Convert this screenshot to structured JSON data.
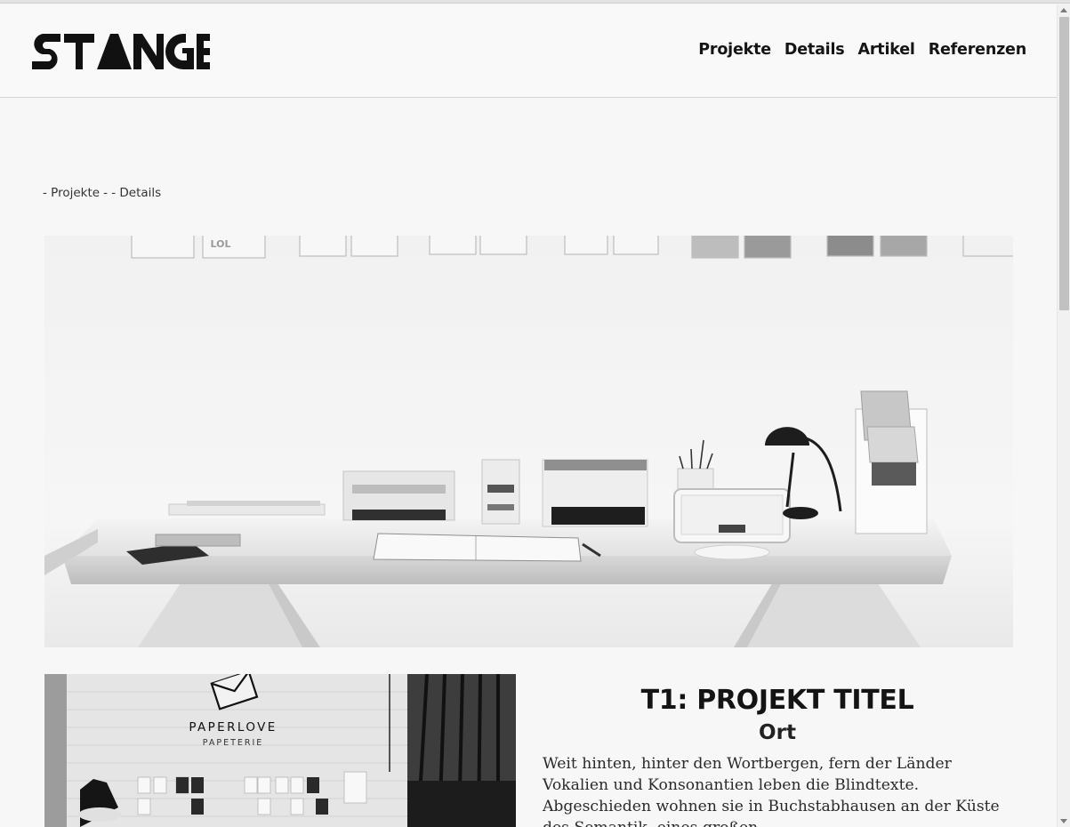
{
  "site": {
    "logo_text": "STANGE"
  },
  "nav": {
    "items": [
      {
        "label": "Projekte"
      },
      {
        "label": "Details"
      },
      {
        "label": "Artikel"
      },
      {
        "label": "Referenzen"
      }
    ]
  },
  "breadcrumb": {
    "parts": [
      "- Projekte",
      "- - Details"
    ]
  },
  "images": {
    "side_photo_text": {
      "brand": "PAPERLOVE",
      "sub": "PAPETERIE"
    }
  },
  "project": {
    "title": "T1: PROJEKT TITEL",
    "location": "Ort",
    "text": "Weit hinten, hinter den Wortbergen, fern der Länder Vokalien und Konsonantien leben die Blindtexte. Abgeschieden wohnen sie in Buchstabhausen an der Küste des Semantik, eines großen"
  },
  "colors": {
    "background": "#f7f7f7",
    "text": "#151515",
    "divider": "#d5d5d5"
  }
}
